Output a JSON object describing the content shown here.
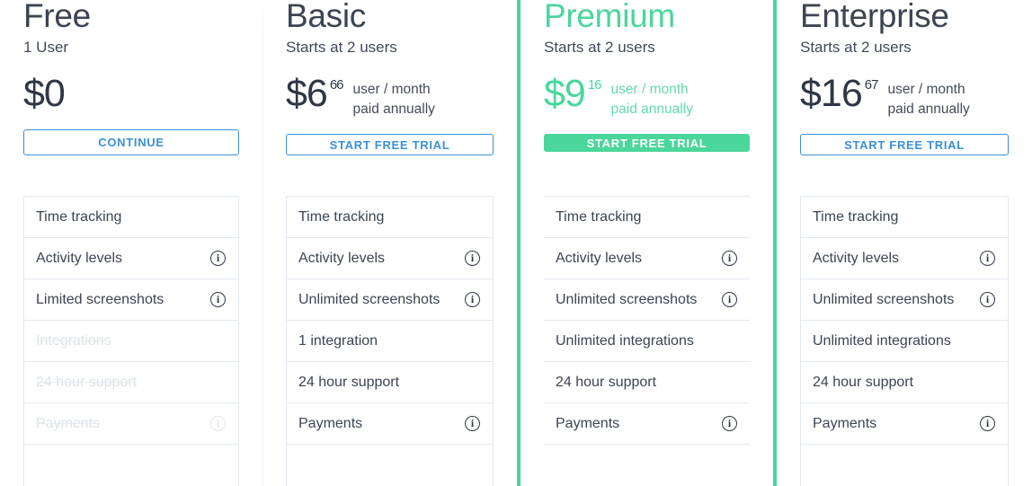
{
  "accent_colors": {
    "green": "#4bd69c",
    "blue": "#3d8fd9",
    "text_dark": "#3c4452",
    "disabled": "#dde2e8",
    "border": "#e3e9f0"
  },
  "terms": {
    "line1": "user / month",
    "line2": "paid annually"
  },
  "icons": {
    "info": "info-icon"
  },
  "plans": [
    {
      "id": "free",
      "name": "Free",
      "subtitle": "1 User",
      "currency": "$",
      "amount": "0",
      "cents": "",
      "show_terms": false,
      "cta_label": "CONTINUE",
      "featured": false,
      "features": [
        {
          "label": "Time tracking",
          "info": false,
          "disabled": false
        },
        {
          "label": "Activity levels",
          "info": true,
          "disabled": false
        },
        {
          "label": "Limited screenshots",
          "info": true,
          "disabled": false
        },
        {
          "label": "Integrations",
          "info": false,
          "disabled": true
        },
        {
          "label": "24 hour support",
          "info": false,
          "disabled": true
        },
        {
          "label": "Payments",
          "info": true,
          "disabled": true
        }
      ]
    },
    {
      "id": "basic",
      "name": "Basic",
      "subtitle": "Starts at 2 users",
      "currency": "$",
      "amount": "6",
      "cents": "66",
      "show_terms": true,
      "cta_label": "START FREE TRIAL",
      "featured": false,
      "features": [
        {
          "label": "Time tracking",
          "info": false,
          "disabled": false
        },
        {
          "label": "Activity levels",
          "info": true,
          "disabled": false
        },
        {
          "label": "Unlimited screenshots",
          "info": true,
          "disabled": false
        },
        {
          "label": "1 integration",
          "info": false,
          "disabled": false
        },
        {
          "label": "24 hour support",
          "info": false,
          "disabled": false
        },
        {
          "label": "Payments",
          "info": true,
          "disabled": false
        }
      ]
    },
    {
      "id": "premium",
      "name": "Premium",
      "subtitle": "Starts at 2 users",
      "currency": "$",
      "amount": "9",
      "cents": "16",
      "show_terms": true,
      "cta_label": "START FREE TRIAL",
      "featured": true,
      "features": [
        {
          "label": "Time tracking",
          "info": false,
          "disabled": false
        },
        {
          "label": "Activity levels",
          "info": true,
          "disabled": false
        },
        {
          "label": "Unlimited screenshots",
          "info": true,
          "disabled": false
        },
        {
          "label": "Unlimited integrations",
          "info": false,
          "disabled": false
        },
        {
          "label": "24 hour support",
          "info": false,
          "disabled": false
        },
        {
          "label": "Payments",
          "info": true,
          "disabled": false
        }
      ]
    },
    {
      "id": "enterprise",
      "name": "Enterprise",
      "subtitle": "Starts at 2 users",
      "currency": "$",
      "amount": "16",
      "cents": "67",
      "show_terms": true,
      "cta_label": "START FREE TRIAL",
      "featured": false,
      "features": [
        {
          "label": "Time tracking",
          "info": false,
          "disabled": false
        },
        {
          "label": "Activity levels",
          "info": true,
          "disabled": false
        },
        {
          "label": "Unlimited screenshots",
          "info": true,
          "disabled": false
        },
        {
          "label": "Unlimited integrations",
          "info": false,
          "disabled": false
        },
        {
          "label": "24 hour support",
          "info": false,
          "disabled": false
        },
        {
          "label": "Payments",
          "info": true,
          "disabled": false
        }
      ]
    }
  ]
}
